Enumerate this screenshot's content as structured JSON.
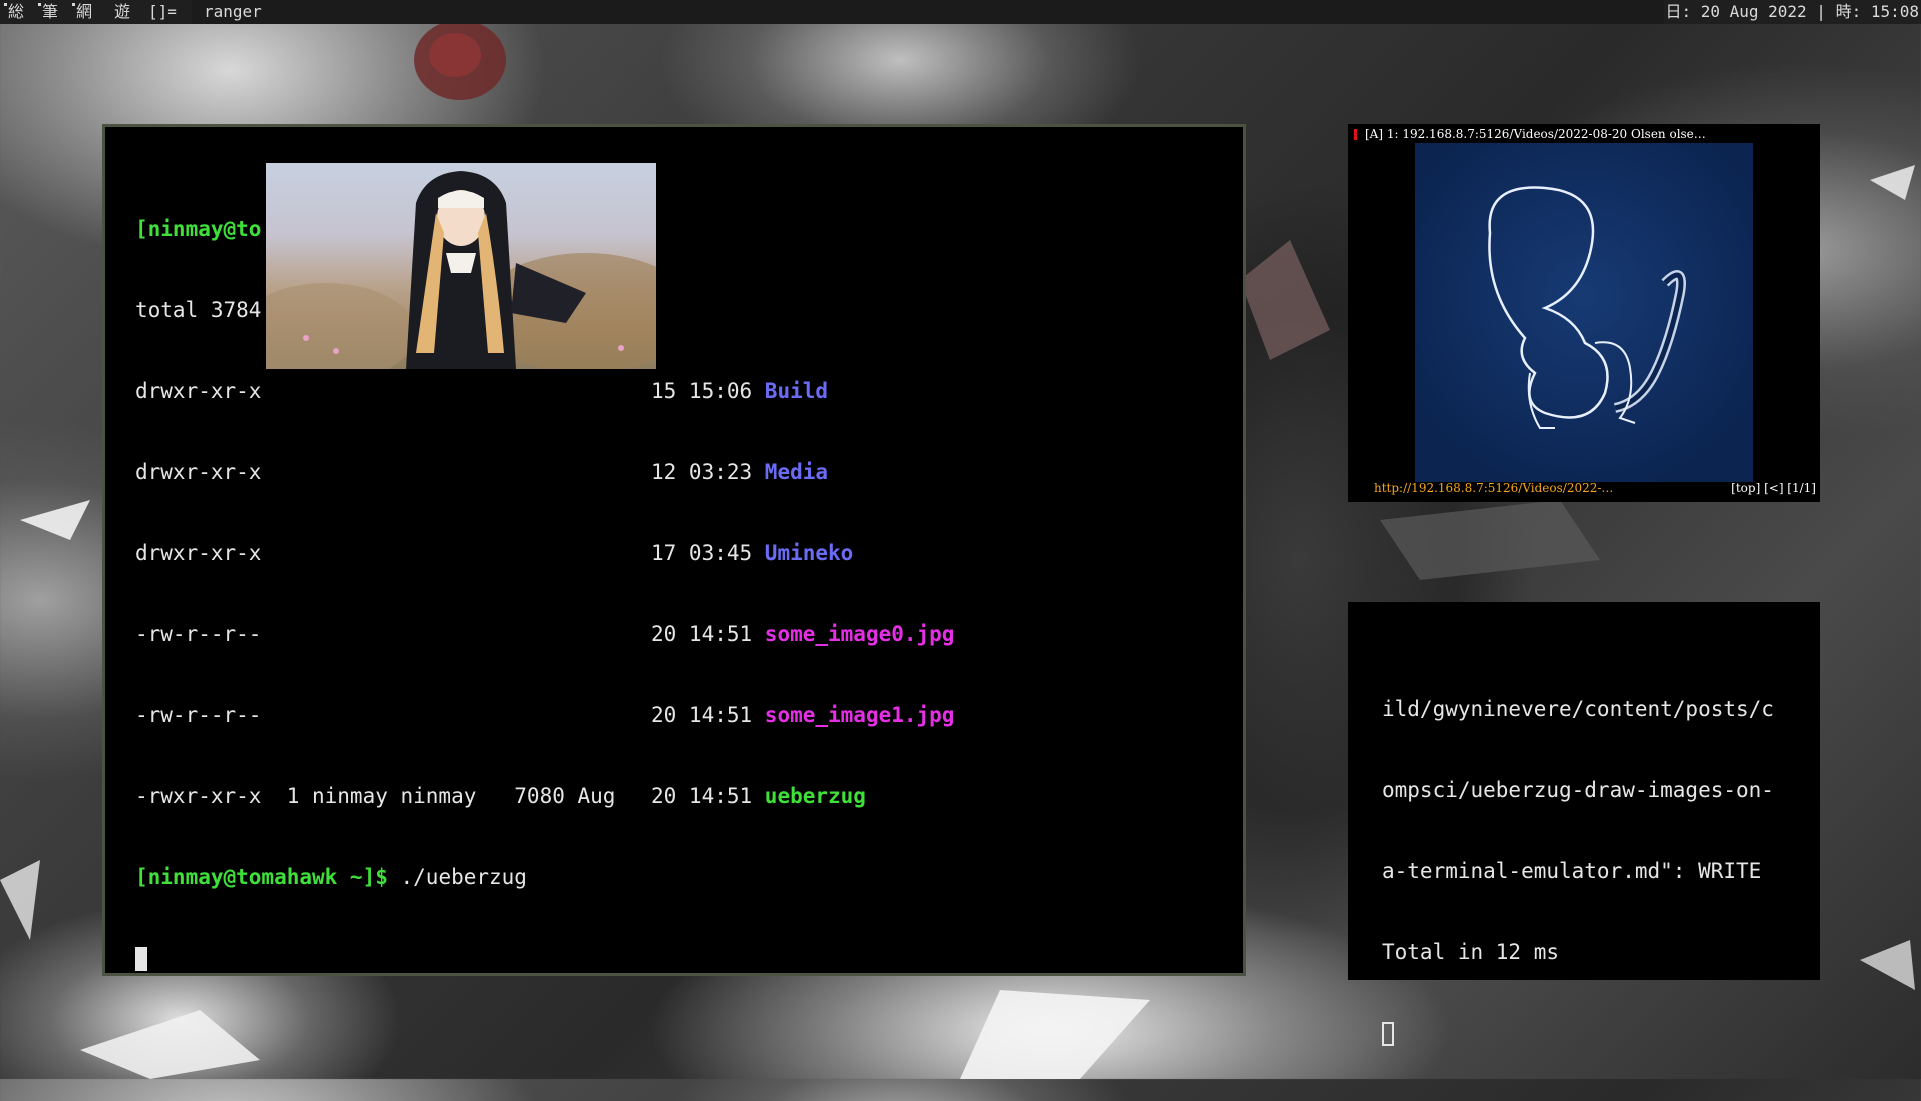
{
  "topbar": {
    "tags": [
      "総",
      "筆",
      "網",
      "遊"
    ],
    "layout_symbol": "[]=",
    "window_title": "ranger",
    "status_text": "日: 20 Aug 2022 | 時: 15:08"
  },
  "terminal_main": {
    "lines": [
      {
        "prompt": "[ninmay@to",
        "rest": ""
      },
      {
        "left": "total 3784",
        "right_time": "",
        "name": "",
        "color": ""
      },
      {
        "left": "drwxr-xr-x",
        "right_time": "15 15:06 ",
        "name": "Build",
        "color": "blue"
      },
      {
        "left": "drwxr-xr-x",
        "right_time": "12 03:23 ",
        "name": "Media",
        "color": "blue"
      },
      {
        "left": "drwxr-xr-x",
        "right_time": "17 03:45 ",
        "name": "Umineko",
        "color": "blue"
      },
      {
        "left": "-rw-r--r--",
        "right_time": "20 14:51 ",
        "name": "some_image0.jpg",
        "color": "magenta"
      },
      {
        "left": "-rw-r--r--",
        "right_time": "20 14:51 ",
        "name": "some_image1.jpg",
        "color": "magenta"
      },
      {
        "left": "-rwxr-xr-x  1 ninmay ninmay   7080 Aug ",
        "right_time": "20 14:51 ",
        "name": "ueberzug",
        "color": "green"
      }
    ],
    "prompt_line": {
      "prompt": "[ninmay@tomahawk ~]$",
      "command": " ./ueberzug"
    }
  },
  "viewer": {
    "title": "[A] 1: 192.168.8.7:5126/Videos/2022-08-20 Olsen olse…",
    "url": "http://192.168.8.7:5126/Videos/2022-…",
    "position": "[top] [<] [1/1]"
  },
  "terminal_side": {
    "lines": [
      "ild/gwyninevere/content/posts/c",
      "ompsci/ueberzug-draw-images-on-",
      "a-terminal-emulator.md\": WRITE",
      "Total in 12 ms"
    ]
  },
  "colors": {
    "prompt_green": "#3fe03a",
    "dir_blue": "#6b6cf6",
    "image_magenta": "#e42fe4",
    "url_orange": "#f3a51e",
    "window_border": "#4b5443"
  }
}
